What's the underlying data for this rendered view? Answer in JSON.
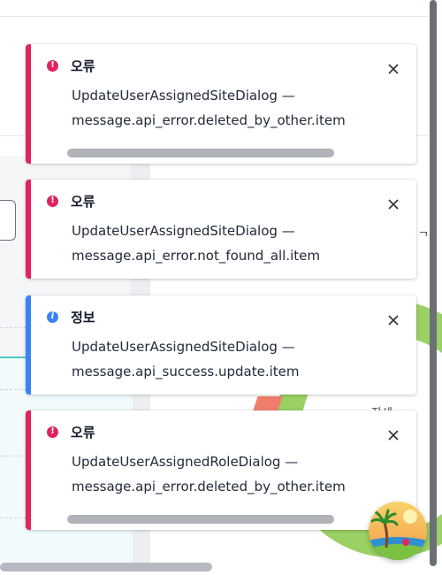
{
  "toasts": [
    {
      "type": "error",
      "title": "오류",
      "lines": [
        "UpdateUserAssignedSiteDialog —",
        "message.api_error.deleted_by_other.item"
      ],
      "close_icon": "close-icon",
      "status_icon": "error-icon",
      "overflow_scrollbar": true
    },
    {
      "type": "error",
      "title": "오류",
      "lines": [
        "UpdateUserAssignedSiteDialog —",
        "message.api_error.not_found_all.item"
      ],
      "close_icon": "close-icon",
      "status_icon": "error-icon",
      "overflow_scrollbar": false
    },
    {
      "type": "info",
      "title": "정보",
      "lines": [
        "UpdateUserAssignedSiteDialog —",
        "message.api_success.update.item"
      ],
      "close_icon": "close-icon",
      "status_icon": "info-icon",
      "overflow_scrollbar": false
    },
    {
      "type": "error",
      "title": "오류",
      "lines": [
        "UpdateUserAssignedRoleDialog —",
        "message.api_error.deleted_by_other.item"
      ],
      "close_icon": "close-icon",
      "status_icon": "error-icon",
      "overflow_scrollbar": true
    }
  ],
  "background": {
    "fragment_text": "자세",
    "fragment_char": "ᄀ"
  },
  "colors": {
    "error": "#e0245e",
    "info": "#3b82f6",
    "chart_green": "#9ad064",
    "chart_red": "#f07c6b",
    "chart_teal": "#4cc7c9"
  },
  "avatar": {
    "icon": "beach-avatar-icon"
  }
}
